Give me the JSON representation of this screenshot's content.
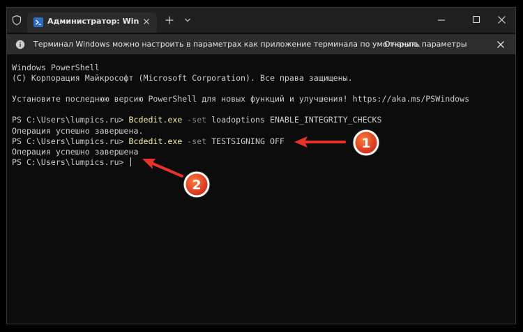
{
  "tab": {
    "title": "Администратор: Windows Pc"
  },
  "banner": {
    "text": "Терминал Windows можно настроить в параметрах как приложение терминала по умолчанию.",
    "link": "Открыть параметры"
  },
  "terminal": {
    "header1": "Windows PowerShell",
    "header2": "(С) Корпорация Майкрософт (Microsoft Corporation). Все права защищены.",
    "hint": "Установите последнюю версию PowerShell для новых функций и улучшения! https://aka.ms/PSWindows",
    "prompt": "PS C:\\Users\\lumpics.ru> ",
    "cmd1": {
      "exe": "Bcdedit.exe",
      "flag": " -set",
      "args": " loadoptions ENABLE_INTEGRITY_CHECKS"
    },
    "out1": "Операция успешно завершена.",
    "cmd2": {
      "exe": "Bcdedit.exe",
      "flag": " -set",
      "args": " TESTSIGNING OFF"
    },
    "out2": "Операция успешно завершена"
  },
  "annotations": {
    "badge1": "1",
    "badge2": "2",
    "color": "#e8322a"
  },
  "icons": [
    "shield-icon",
    "powershell-icon",
    "close-icon",
    "plus-icon",
    "chevron-down-icon",
    "minimize-icon",
    "maximize-icon",
    "info-icon"
  ]
}
